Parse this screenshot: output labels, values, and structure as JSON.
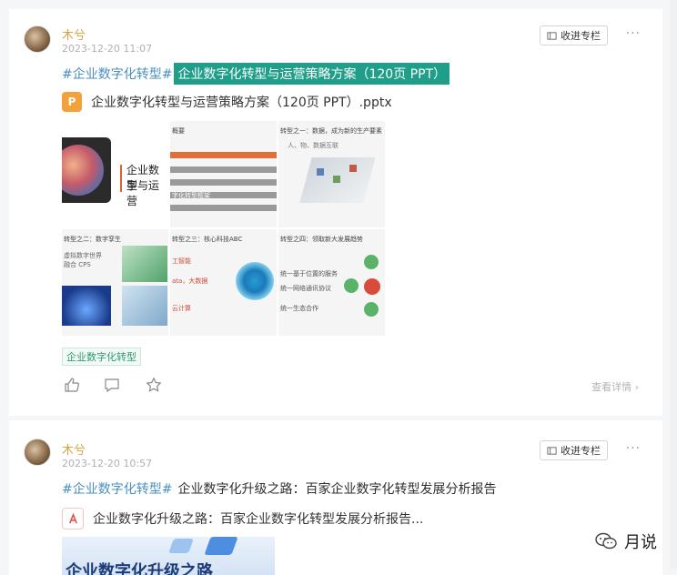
{
  "posts": [
    {
      "author": "木兮",
      "date": "2023-12-20 11:07",
      "collect_label": "收进专栏",
      "more": "···",
      "hashtag": "#企业数字化转型#",
      "title": "企业数字化转型与运营策略方案（120页 PPT）",
      "file_name": "企业数字化转型与运营策略方案（120页 PPT）.pptx",
      "file_icon": "ppt-file-icon",
      "slides": {
        "s1_title_a": "企业数字",
        "s1_title_b": "型与运营",
        "s2_heading": "概要",
        "s2_row": "字化转型框架",
        "s3_heading": "转型之一：数据，成为新的生产要素",
        "s3_note": "人、物、数据互联",
        "s4_heading": "转型之二：数字孪生",
        "s4_line1": "虚拟数字世界",
        "s4_line2": "融合 CPS",
        "s5_heading": "转型之三：核心科技ABC",
        "s5_line1": "工智能",
        "s5_line2": "ata，大数据",
        "s5_line3": "云计算",
        "s6_heading": "转型之四：领取新大发展趋势",
        "s6_line1": "统一基于位置的服务",
        "s6_line2": "统一网络通讯协议",
        "s6_line3": "统一生态合作"
      },
      "tag": "企业数字化转型",
      "detail": "查看详情 ›"
    },
    {
      "author": "木兮",
      "date": "2023-12-20 10:57",
      "collect_label": "收进专栏",
      "more": "···",
      "hashtag": "#企业数字化转型#",
      "title": "企业数字化升级之路：百家企业数字化转型发展分析报告",
      "file_name": "企业数字化升级之路：百家企业数字化转型发展分析报告...",
      "file_icon": "pdf-file-icon",
      "preview_text": "企业数字化升级之路"
    }
  ],
  "watermark": "月说",
  "colors": {
    "author": "#d9a441",
    "highlight": "#1f9e89",
    "hashtag": "#4a8fc1",
    "tag": "#2f9a70"
  }
}
